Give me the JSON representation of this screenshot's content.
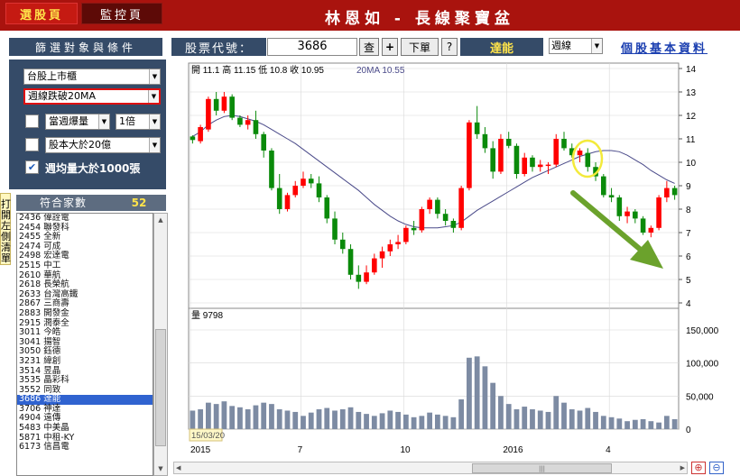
{
  "top_tabs": {
    "select": "選股頁",
    "monitor": "監控頁"
  },
  "app_title": "林恩如 - 長線聚寶盆",
  "filter_header": "篩選對象與條件",
  "stock_code_label": "股票代號：",
  "stock_code": "3686",
  "buttons": {
    "query": "查",
    "add": "+",
    "order": "下單",
    "help": "?"
  },
  "stock_name": "達能",
  "period": "週線",
  "basic_info_link": "個股基本資料",
  "filters": {
    "market": "台股上市櫃",
    "condition": "週線跌破20MA",
    "check1": {
      "checked": false,
      "option": "當週爆量",
      "multiplier": "1倍"
    },
    "check2": {
      "checked": false,
      "option": "股本大於20億"
    },
    "check3": {
      "checked": true,
      "label": "週均量大於1000張"
    }
  },
  "side_tab": "打開左側清單",
  "match_count_label": "符合家數",
  "match_count": "52",
  "stock_list": [
    {
      "code": "2436",
      "name": "偉詮電"
    },
    {
      "code": "2454",
      "name": "聯發科"
    },
    {
      "code": "2455",
      "name": "全新"
    },
    {
      "code": "2474",
      "name": "可成"
    },
    {
      "code": "2498",
      "name": "宏達電"
    },
    {
      "code": "2515",
      "name": "中工"
    },
    {
      "code": "2610",
      "name": "華航"
    },
    {
      "code": "2618",
      "name": "長榮航"
    },
    {
      "code": "2633",
      "name": "台灣高鐵"
    },
    {
      "code": "2867",
      "name": "三商壽"
    },
    {
      "code": "2883",
      "name": "開發金"
    },
    {
      "code": "2915",
      "name": "潤泰全"
    },
    {
      "code": "3011",
      "name": "今皓"
    },
    {
      "code": "3041",
      "name": "揚智"
    },
    {
      "code": "3050",
      "name": "鈺德"
    },
    {
      "code": "3231",
      "name": "緯創"
    },
    {
      "code": "3514",
      "name": "昱晶"
    },
    {
      "code": "3535",
      "name": "晶彩科"
    },
    {
      "code": "3552",
      "name": "同致"
    },
    {
      "code": "3686",
      "name": "達能"
    },
    {
      "code": "3706",
      "name": "神達"
    },
    {
      "code": "4904",
      "name": "遠傳"
    },
    {
      "code": "5483",
      "name": "中美晶"
    },
    {
      "code": "5871",
      "name": "中租-KY"
    },
    {
      "code": "6173",
      "name": "信昌電"
    }
  ],
  "selected_code": "3686",
  "ohlc_label": "開 11.1  高 11.15  低 10.8  收 10.95",
  "ma_label": "20MA 10.55",
  "volume_label": "量 9798",
  "date_tooltip": "15/03/20",
  "colors": {
    "up": "#ff0000",
    "down": "#0a8a0a",
    "ma": "#4b4b8a",
    "volume": "#7d8ba3",
    "arrow": "#6ba22c",
    "highlight": "#f3ea3b",
    "header": "#a9130e",
    "panel": "#354b68"
  },
  "chart_data": [
    {
      "type": "candlestick",
      "title": "",
      "ylim": [
        4,
        14
      ],
      "y_ticks": [
        4,
        5,
        6,
        7,
        8,
        9,
        10,
        11,
        12,
        13,
        14
      ],
      "x_ticks": [
        {
          "week": 0,
          "label": "2015"
        },
        {
          "week": 14,
          "label": "7"
        },
        {
          "week": 27,
          "label": "10"
        },
        {
          "week": 40,
          "label": "2016"
        },
        {
          "week": 53,
          "label": "4"
        }
      ],
      "weeks": 62,
      "ohlc": [
        [
          11.1,
          11.15,
          10.8,
          10.95
        ],
        [
          10.9,
          11.6,
          10.8,
          11.5
        ],
        [
          11.4,
          12.8,
          11.3,
          12.7
        ],
        [
          12.7,
          13.0,
          12.0,
          12.2
        ],
        [
          12.2,
          13.0,
          12.1,
          12.8
        ],
        [
          12.8,
          12.9,
          11.8,
          11.9
        ],
        [
          11.9,
          12.0,
          11.5,
          11.6
        ],
        [
          11.6,
          12.0,
          11.4,
          11.8
        ],
        [
          11.8,
          12.2,
          11.0,
          11.2
        ],
        [
          11.2,
          11.3,
          10.2,
          10.5
        ],
        [
          10.5,
          10.6,
          8.8,
          8.9
        ],
        [
          8.9,
          9.5,
          7.8,
          8.0
        ],
        [
          8.0,
          8.7,
          7.9,
          8.6
        ],
        [
          8.6,
          9.2,
          8.5,
          9.0
        ],
        [
          9.0,
          9.6,
          8.9,
          9.3
        ],
        [
          9.3,
          9.5,
          8.9,
          9.1
        ],
        [
          9.1,
          9.4,
          8.3,
          8.5
        ],
        [
          8.5,
          8.6,
          7.4,
          7.6
        ],
        [
          7.6,
          7.9,
          6.5,
          6.7
        ],
        [
          6.7,
          7.0,
          6.1,
          6.3
        ],
        [
          6.3,
          6.5,
          5.0,
          5.2
        ],
        [
          5.2,
          5.6,
          4.6,
          4.9
        ],
        [
          4.9,
          5.6,
          4.8,
          5.3
        ],
        [
          5.3,
          6.1,
          5.2,
          5.9
        ],
        [
          5.9,
          6.4,
          5.5,
          6.2
        ],
        [
          6.2,
          6.7,
          6.0,
          6.5
        ],
        [
          6.5,
          6.9,
          6.3,
          6.6
        ],
        [
          6.6,
          7.3,
          6.5,
          7.2
        ],
        [
          7.2,
          7.5,
          6.9,
          7.1
        ],
        [
          7.1,
          8.1,
          7.0,
          8.0
        ],
        [
          8.0,
          8.5,
          7.8,
          8.4
        ],
        [
          8.4,
          8.5,
          7.6,
          7.8
        ],
        [
          7.8,
          8.0,
          7.3,
          7.5
        ],
        [
          7.5,
          7.6,
          7.0,
          7.2
        ],
        [
          7.2,
          9.0,
          7.1,
          8.9
        ],
        [
          8.9,
          11.8,
          8.8,
          11.7
        ],
        [
          11.7,
          12.4,
          11.0,
          11.2
        ],
        [
          11.2,
          11.5,
          10.4,
          10.6
        ],
        [
          10.6,
          10.9,
          9.3,
          9.6
        ],
        [
          9.6,
          11.2,
          9.5,
          11.0
        ],
        [
          11.0,
          11.3,
          10.6,
          10.7
        ],
        [
          10.7,
          10.8,
          9.3,
          9.5
        ],
        [
          9.5,
          10.4,
          9.4,
          10.2
        ],
        [
          10.2,
          10.3,
          9.6,
          9.8
        ],
        [
          9.8,
          10.1,
          9.6,
          9.9
        ],
        [
          9.9,
          10.0,
          9.5,
          9.9
        ],
        [
          9.9,
          11.2,
          9.8,
          11.0
        ],
        [
          11.0,
          11.3,
          10.5,
          10.6
        ],
        [
          10.6,
          10.8,
          10.2,
          10.3
        ],
        [
          10.3,
          10.6,
          10.0,
          10.5
        ],
        [
          10.4,
          10.6,
          9.6,
          9.8
        ],
        [
          9.8,
          10.0,
          9.2,
          9.4
        ],
        [
          9.4,
          9.5,
          8.5,
          8.6
        ],
        [
          8.6,
          8.9,
          8.3,
          8.5
        ],
        [
          8.5,
          8.6,
          7.5,
          7.7
        ],
        [
          7.7,
          8.1,
          7.4,
          7.9
        ],
        [
          7.9,
          8.0,
          7.4,
          7.6
        ],
        [
          7.6,
          7.7,
          6.9,
          7.0
        ],
        [
          7.0,
          7.3,
          6.8,
          7.2
        ],
        [
          7.2,
          8.6,
          7.1,
          8.5
        ],
        [
          8.5,
          9.2,
          8.3,
          8.9
        ],
        [
          8.9,
          9.0,
          8.4,
          8.6
        ]
      ],
      "ma20": [
        11.1,
        11.3,
        11.6,
        11.8,
        11.95,
        12.0,
        11.95,
        11.85,
        11.75,
        11.6,
        11.4,
        11.2,
        11.0,
        10.8,
        10.55,
        10.3,
        10.05,
        9.8,
        9.55,
        9.3,
        9.05,
        8.8,
        8.5,
        8.2,
        7.95,
        7.7,
        7.5,
        7.35,
        7.25,
        7.2,
        7.2,
        7.2,
        7.25,
        7.3,
        7.45,
        7.7,
        7.95,
        8.15,
        8.35,
        8.55,
        8.75,
        8.95,
        9.15,
        9.35,
        9.5,
        9.65,
        9.8,
        9.95,
        10.1,
        10.25,
        10.35,
        10.45,
        10.5,
        10.5,
        10.45,
        10.3,
        10.1,
        9.9,
        9.65,
        9.45,
        9.25,
        9.1
      ]
    },
    {
      "type": "bar",
      "title": "",
      "ylim": [
        0,
        150000
      ],
      "y_ticks": [
        0,
        50000,
        100000,
        150000
      ],
      "values": [
        28000,
        30000,
        40000,
        38000,
        42000,
        35000,
        33000,
        30000,
        36000,
        40000,
        38000,
        30000,
        28000,
        26000,
        20000,
        25000,
        30000,
        32000,
        28000,
        30000,
        33000,
        26000,
        23000,
        20000,
        24000,
        28000,
        26000,
        22000,
        18000,
        20000,
        25000,
        22000,
        20000,
        18000,
        45000,
        108000,
        110000,
        95000,
        70000,
        50000,
        38000,
        30000,
        34000,
        30000,
        28000,
        26000,
        50000,
        40000,
        30000,
        28000,
        32000,
        26000,
        20000,
        18000,
        16000,
        12000,
        14000,
        15000,
        12000,
        10000,
        20000,
        15000
      ]
    }
  ]
}
